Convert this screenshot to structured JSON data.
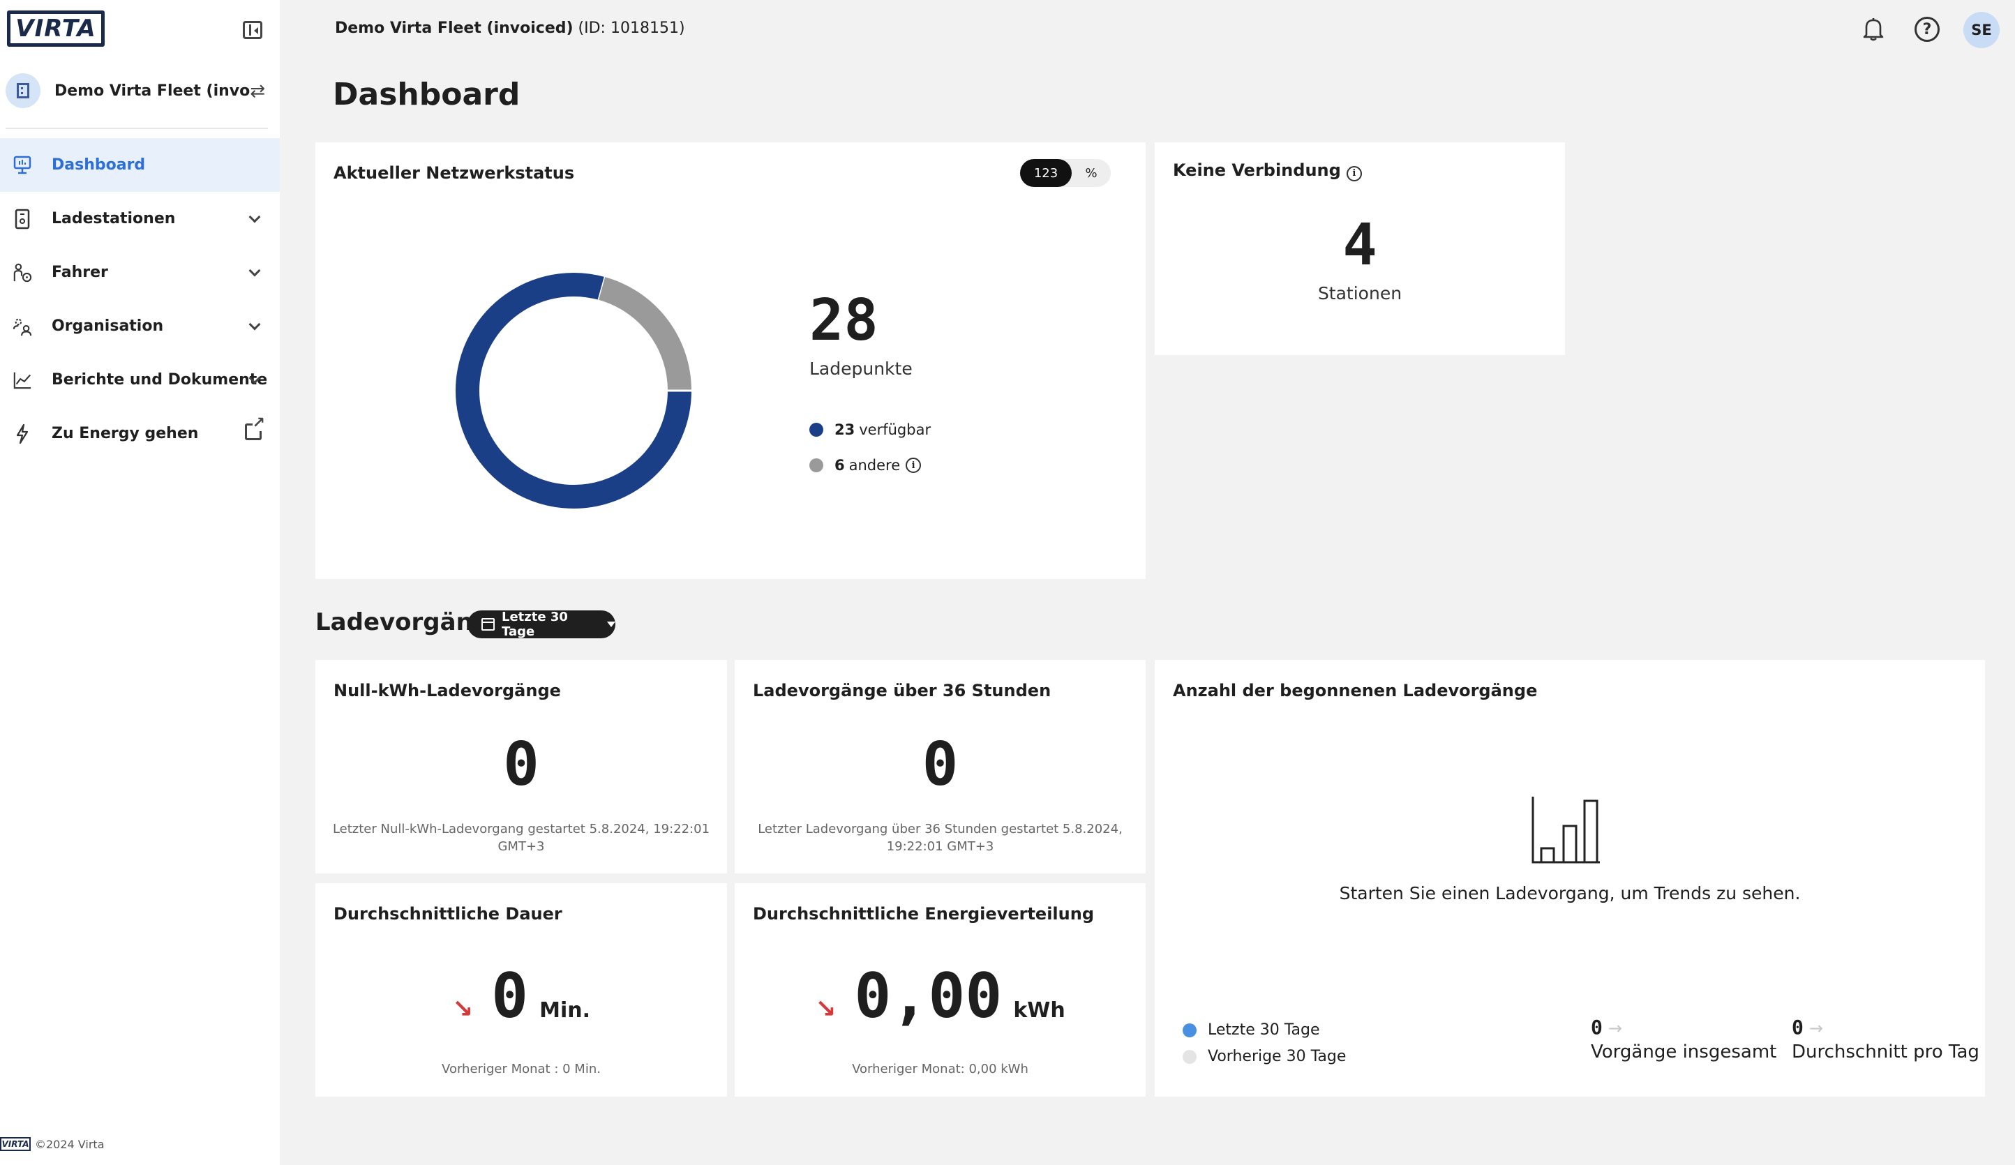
{
  "sidebar": {
    "logo_text": "VIRTA",
    "org_name": "Demo Virta Fleet (invoi...",
    "items": [
      {
        "label": "Dashboard",
        "icon": "monitor-icon"
      },
      {
        "label": "Ladestationen",
        "icon": "charger-icon"
      },
      {
        "label": "Fahrer",
        "icon": "driver-icon"
      },
      {
        "label": "Organisation",
        "icon": "people-icon"
      },
      {
        "label": "Berichte und Dokumente",
        "icon": "chart-line-icon"
      },
      {
        "label": "Zu Energy gehen",
        "icon": "lightning-icon"
      }
    ],
    "footer_logo": "VIRTA",
    "footer_text": "©2024 Virta"
  },
  "header": {
    "fleet_name": "Demo Virta Fleet (invoiced)",
    "fleet_id": "(ID: 1018151)",
    "user_initials": "SE"
  },
  "page_title": "Dashboard",
  "network": {
    "title": "Aktueller Netzwerkstatus",
    "toggle_count": "123",
    "toggle_percent": "%",
    "total": "28",
    "total_label": "Ladepunkte",
    "available_count": "23",
    "available_label": "verfügbar",
    "other_count": "6",
    "other_label": "andere",
    "colors": {
      "available": "#1b3f86",
      "other": "#9a9a9a"
    }
  },
  "chart_data": {
    "type": "pie",
    "categories": [
      "verfügbar",
      "andere"
    ],
    "values": [
      23,
      6
    ]
  },
  "no_connection": {
    "title": "Keine Verbindung",
    "value": "4",
    "label": "Stationen"
  },
  "sessions": {
    "title": "Ladevorgänge",
    "range": "Letzte 30 Tage",
    "zero_kwh": {
      "title": "Null-kWh-Ladevorgänge",
      "value": "0",
      "foot": "Letzter Null-kWh-Ladevorgang gestartet 5.8.2024, 19:22:01 GMT+3"
    },
    "over_36h": {
      "title": "Ladevorgänge über 36 Stunden",
      "value": "0",
      "foot": "Letzter Ladevorgang über 36 Stunden gestartet 5.8.2024, 19:22:01 GMT+3"
    },
    "avg_duration": {
      "title": "Durchschnittliche Dauer",
      "value": "0",
      "unit": "Min.",
      "foot": "Vorheriger Monat : 0 Min."
    },
    "avg_energy": {
      "title": "Durchschnittliche Energieverteilung",
      "value": "0,00",
      "unit": "kWh",
      "foot": "Vorheriger Monat: 0,00 kWh"
    },
    "started": {
      "title": "Anzahl der begonnenen Ladevorgänge",
      "message": "Starten Sie einen Ladevorgang, um Trends zu sehen.",
      "legend_current": "Letzte 30 Tage",
      "legend_previous": "Vorherige 30 Tage",
      "total_value": "0",
      "total_label": "Vorgänge insgesamt",
      "avg_value": "0",
      "avg_label": "Durchschnitt pro Tag",
      "colors": {
        "current": "#4a90e2",
        "previous": "#e4e4e4"
      }
    }
  }
}
